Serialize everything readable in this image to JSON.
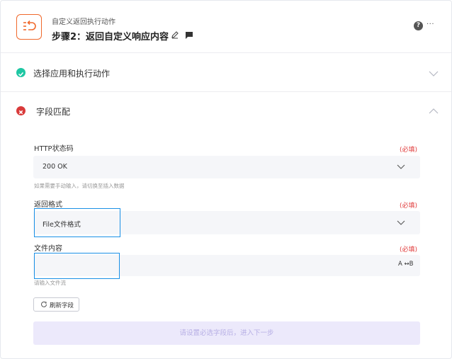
{
  "header": {
    "subtitle": "自定义返回执行动作",
    "title": "步骤2：返回自定义响应内容",
    "help_label": "?",
    "more_label": "···",
    "app_icon": "return-action-icon",
    "brand_color": "#f0692c"
  },
  "sections": {
    "select_app": {
      "title": "选择应用和执行动作",
      "status": "success",
      "status_color": "#1ec7a3",
      "expanded": false
    },
    "field_match": {
      "title": "字段匹配",
      "status": "error",
      "status_color": "#d93a3a",
      "expanded": true
    }
  },
  "form": {
    "http_status": {
      "label": "HTTP状态码",
      "required": "(必填)",
      "value": "200 OK",
      "hint": "如果需要手动输入，请切换至插入数据"
    },
    "return_format": {
      "label": "返回格式",
      "required": "(必填)",
      "value": "File文件格式"
    },
    "file_content": {
      "label": "文件内容",
      "required": "(必填)",
      "value": "",
      "toggle_label": "A ↔B",
      "hint": "请输入文件流"
    },
    "refresh_label": "刷新字段",
    "next_label": "请设置必选字段后，进入下一步"
  },
  "colors": {
    "highlight": "#1a90e6",
    "required": "#e03c3c",
    "next_bg": "#ece9fb",
    "next_text": "#b7afe5"
  }
}
